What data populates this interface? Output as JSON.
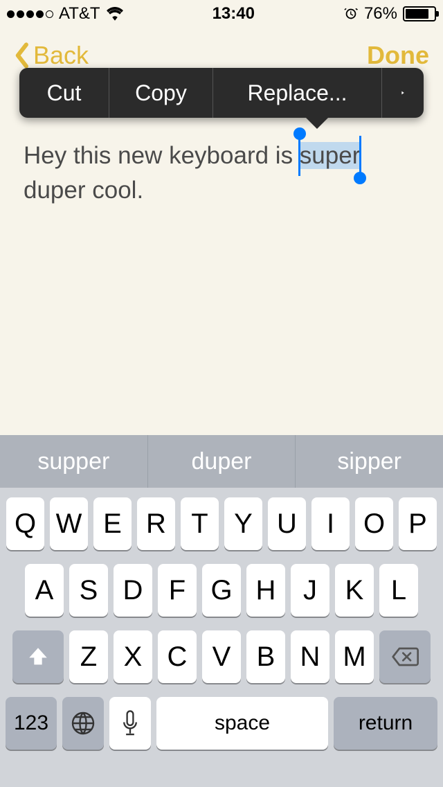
{
  "status": {
    "carrier": "AT&T",
    "time": "13:40",
    "battery_pct": "76%"
  },
  "nav": {
    "back_label": "Back",
    "done_label": "Done"
  },
  "edit_menu": {
    "cut": "Cut",
    "copy": "Copy",
    "replace": "Replace..."
  },
  "note": {
    "text_before": "Hey this new keyboard is ",
    "selected_text": "super",
    "text_after": " duper cool."
  },
  "suggestions": [
    "supper",
    "duper",
    "sipper"
  ],
  "keyboard": {
    "row1": [
      "Q",
      "W",
      "E",
      "R",
      "T",
      "Y",
      "U",
      "I",
      "O",
      "P"
    ],
    "row2": [
      "A",
      "S",
      "D",
      "F",
      "G",
      "H",
      "J",
      "K",
      "L"
    ],
    "row3": [
      "Z",
      "X",
      "C",
      "V",
      "B",
      "N",
      "M"
    ],
    "numbers_label": "123",
    "space_label": "space",
    "return_label": "return"
  }
}
